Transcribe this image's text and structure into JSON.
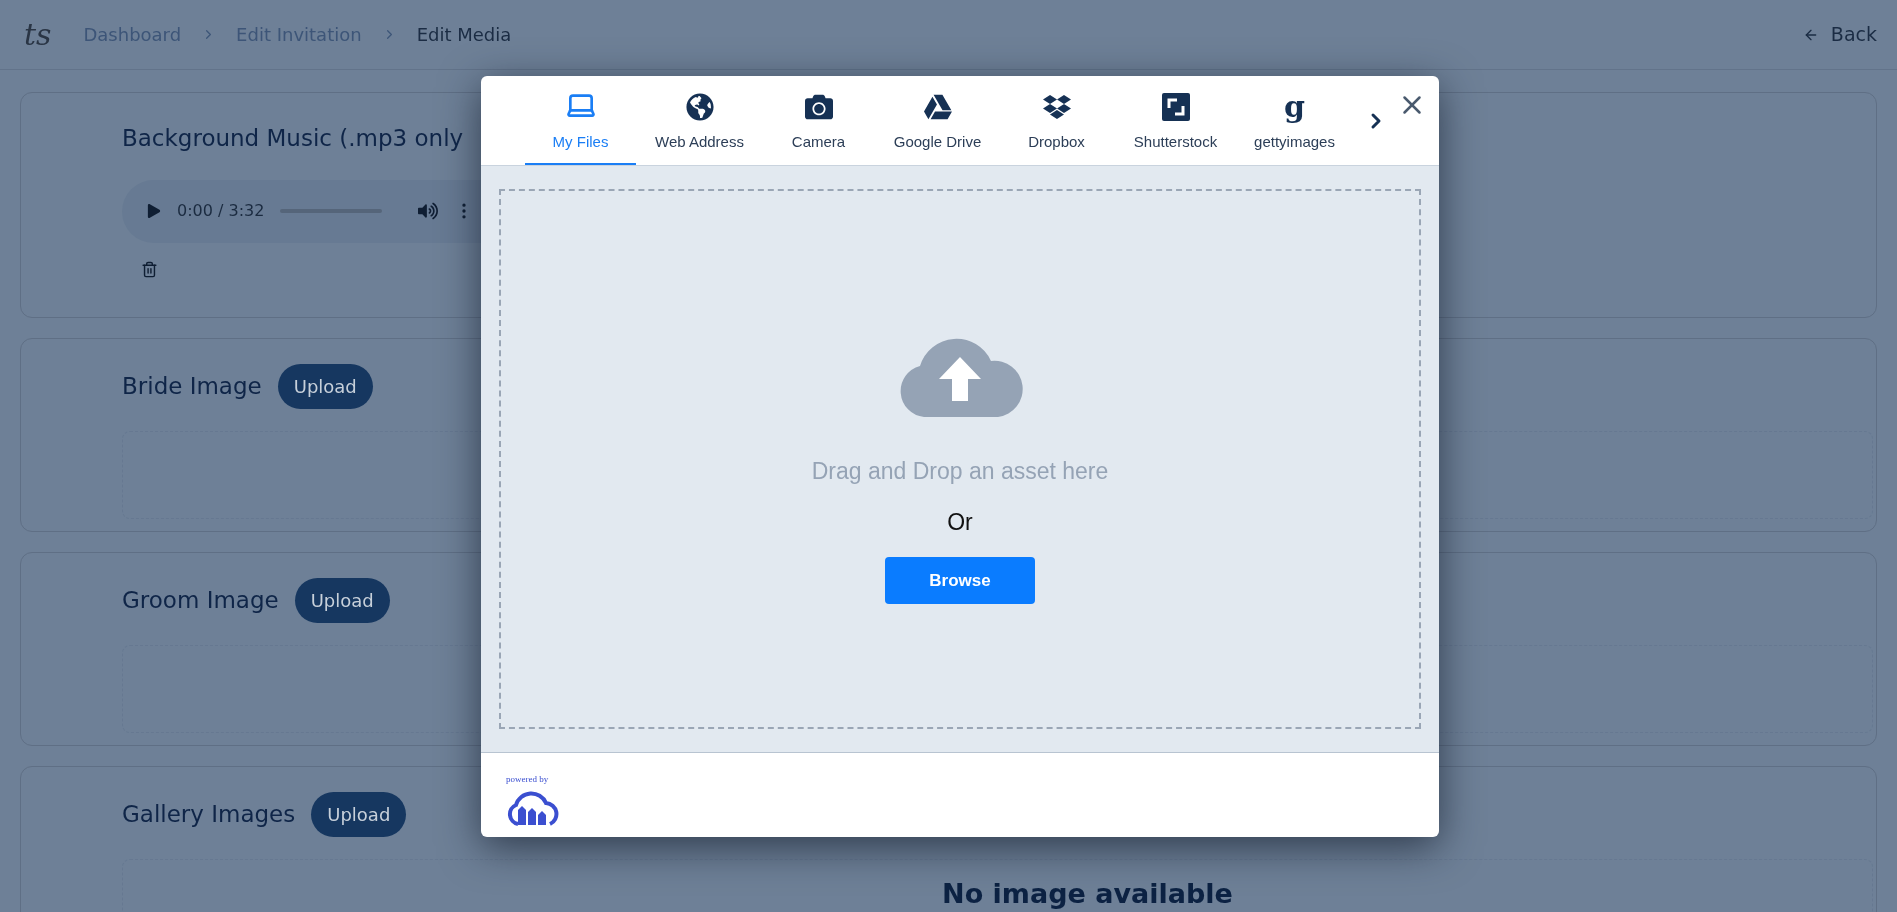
{
  "header": {
    "logo": "ts",
    "breadcrumbs": [
      {
        "label": "Dashboard",
        "current": false
      },
      {
        "label": "Edit Invitation",
        "current": false
      },
      {
        "label": "Edit Media",
        "current": true
      }
    ],
    "back": "Back"
  },
  "sections": [
    {
      "kind": "audio",
      "title": "Background Music (.mp3 only",
      "player": {
        "time": "0:00 / 3:32"
      }
    },
    {
      "kind": "image",
      "title": "Bride Image",
      "button": "Upload"
    },
    {
      "kind": "image",
      "title": "Groom Image",
      "button": "Upload"
    },
    {
      "kind": "image",
      "title": "Gallery Images",
      "button": "Upload",
      "empty_text": "No image available"
    }
  ],
  "modal": {
    "tabs": [
      {
        "label": "My Files",
        "selected": true
      },
      {
        "label": "Web Address",
        "selected": false
      },
      {
        "label": "Camera",
        "selected": false
      },
      {
        "label": "Google Drive",
        "selected": false
      },
      {
        "label": "Dropbox",
        "selected": false
      },
      {
        "label": "Shutterstock",
        "selected": false
      },
      {
        "label": "gettyimages",
        "selected": false,
        "icon_text": "g"
      }
    ],
    "drop_text": "Drag and Drop an asset here",
    "or_text": "Or",
    "browse": "Browse",
    "powered_by": "powered by"
  }
}
